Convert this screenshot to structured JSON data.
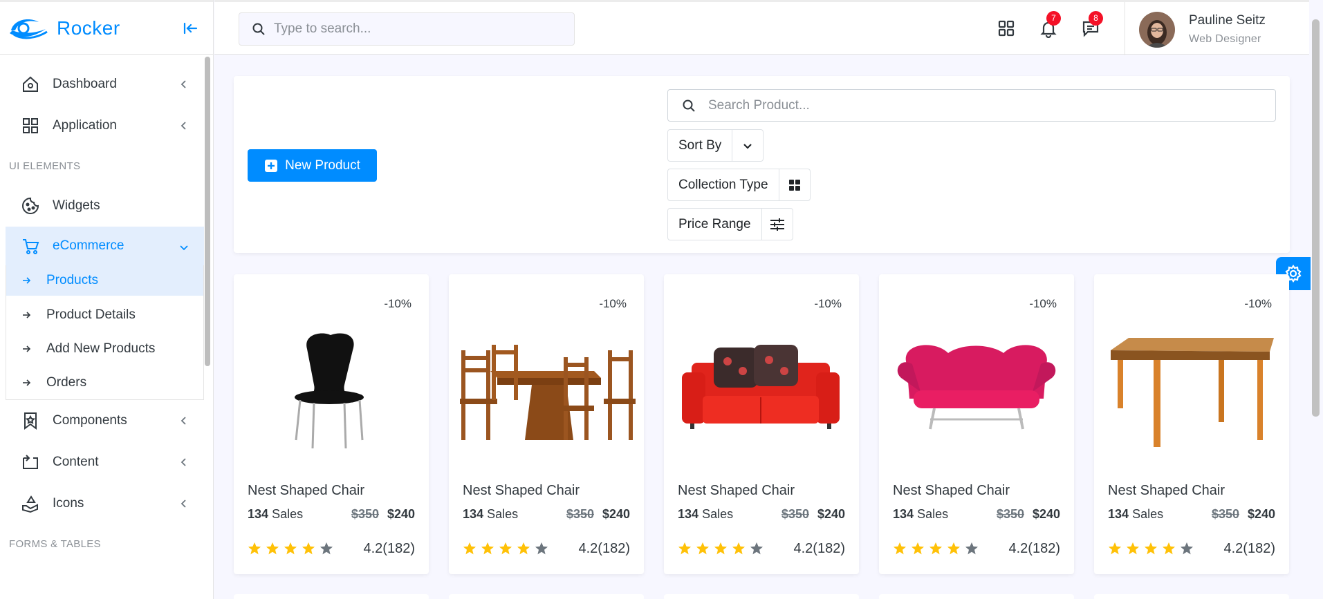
{
  "brand": {
    "name": "Rocker"
  },
  "sidebar": {
    "items": [
      {
        "label": "Dashboard",
        "icon": "home-icon"
      },
      {
        "label": "Application",
        "icon": "grid-icon"
      }
    ],
    "section_ui": "UI ELEMENTS",
    "widgets_label": "Widgets",
    "ecommerce_label": "eCommerce",
    "sub_items": [
      {
        "label": "Products"
      },
      {
        "label": "Product Details"
      },
      {
        "label": "Add New Products"
      },
      {
        "label": "Orders"
      }
    ],
    "items_after": [
      {
        "label": "Components",
        "icon": "bookmark-icon"
      },
      {
        "label": "Content",
        "icon": "repeat-icon"
      },
      {
        "label": "Icons",
        "icon": "donate-icon"
      }
    ],
    "section_forms": "FORMS & TABLES"
  },
  "topbar": {
    "search_placeholder": "Type to search...",
    "notifications_count": "7",
    "messages_count": "8",
    "user_name": "Pauline Seitz",
    "user_role": "Web Designer"
  },
  "toolbar": {
    "new_product_label": "New Product",
    "search_placeholder": "Search Product...",
    "sort_by_label": "Sort By",
    "collection_type_label": "Collection Type",
    "price_range_label": "Price Range"
  },
  "products": [
    {
      "name": "Nest Shaped Chair",
      "discount": "-10%",
      "sales_count": "134",
      "sales_label": "Sales",
      "old_price": "$350",
      "price": "$240",
      "rating": "4.2(182)",
      "stars": 4
    },
    {
      "name": "Nest Shaped Chair",
      "discount": "-10%",
      "sales_count": "134",
      "sales_label": "Sales",
      "old_price": "$350",
      "price": "$240",
      "rating": "4.2(182)",
      "stars": 4
    },
    {
      "name": "Nest Shaped Chair",
      "discount": "-10%",
      "sales_count": "134",
      "sales_label": "Sales",
      "old_price": "$350",
      "price": "$240",
      "rating": "4.2(182)",
      "stars": 4
    },
    {
      "name": "Nest Shaped Chair",
      "discount": "-10%",
      "sales_count": "134",
      "sales_label": "Sales",
      "old_price": "$350",
      "price": "$240",
      "rating": "4.2(182)",
      "stars": 4
    },
    {
      "name": "Nest Shaped Chair",
      "discount": "-10%",
      "sales_count": "134",
      "sales_label": "Sales",
      "old_price": "$350",
      "price": "$240",
      "rating": "4.2(182)",
      "stars": 4
    }
  ],
  "colors": {
    "primary": "#008cff",
    "star": "#ffc107",
    "badge": "#f41127"
  }
}
